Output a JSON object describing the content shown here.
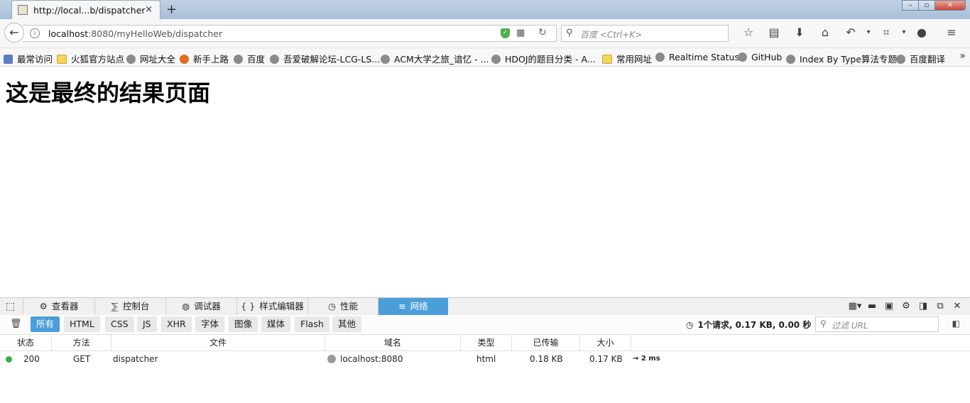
{
  "window": {
    "tab_title": "http://local...b/dispatcher",
    "new_tab": "+",
    "tab_close": "×"
  },
  "nav": {
    "url_host": "localhost",
    "url_path": ":8080/myHelloWeb/dispatcher",
    "search_placeholder": "百度 <Ctrl+K>"
  },
  "bookmarks": [
    {
      "label": "最常访问",
      "icon": "bookmark-book-icon"
    },
    {
      "label": "火狐官方站点",
      "icon": "folder-icon"
    },
    {
      "label": "网址大全",
      "icon": "globe-icon"
    },
    {
      "label": "新手上路",
      "icon": "firefox-icon"
    },
    {
      "label": "百度",
      "icon": "globe-icon"
    },
    {
      "label": "吾爱破解论坛-LCG-LS...",
      "icon": "globe-icon"
    },
    {
      "label": "ACM大学之旅_谙忆 - ...",
      "icon": "globe-icon"
    },
    {
      "label": "HDOJ的题目分类 - A...",
      "icon": "globe-icon"
    },
    {
      "label": "常用网址",
      "icon": "folder-icon"
    },
    {
      "label": "Realtime Status",
      "icon": "globe-icon"
    },
    {
      "label": "GitHub",
      "icon": "globe-icon"
    },
    {
      "label": "Index By Type算法专题",
      "icon": "globe-icon"
    },
    {
      "label": "百度翻译",
      "icon": "globe-icon"
    }
  ],
  "page": {
    "heading": "这是最终的结果页面"
  },
  "devtools": {
    "tabs": [
      {
        "label": "查看器",
        "icon": "inspector-icon"
      },
      {
        "label": "控制台",
        "icon": "console-icon"
      },
      {
        "label": "调试器",
        "icon": "debugger-icon"
      },
      {
        "label": "样式编辑器",
        "icon": "style-editor-icon"
      },
      {
        "label": "性能",
        "icon": "performance-icon"
      },
      {
        "label": "网络",
        "icon": "network-icon",
        "active": true
      }
    ],
    "filters": [
      "所有",
      "HTML",
      "CSS",
      "JS",
      "XHR",
      "字体",
      "图像",
      "媒体",
      "Flash",
      "其他"
    ],
    "active_filter": "所有",
    "summary": "1个请求, 0.17 KB, 0.00 秒",
    "filter_placeholder": "过滤 URL",
    "columns": [
      "状态",
      "方法",
      "文件",
      "域名",
      "类型",
      "已传输",
      "大小"
    ],
    "requests": [
      {
        "status": "200",
        "status_color": "#3eae3e",
        "method": "GET",
        "file": "dispatcher",
        "domain": "localhost:8080",
        "type": "html",
        "transferred": "0.18 KB",
        "size": "0.17 KB",
        "timing": "→ 2 ms"
      }
    ]
  },
  "colors": {
    "accent": "#4c9ed9"
  }
}
